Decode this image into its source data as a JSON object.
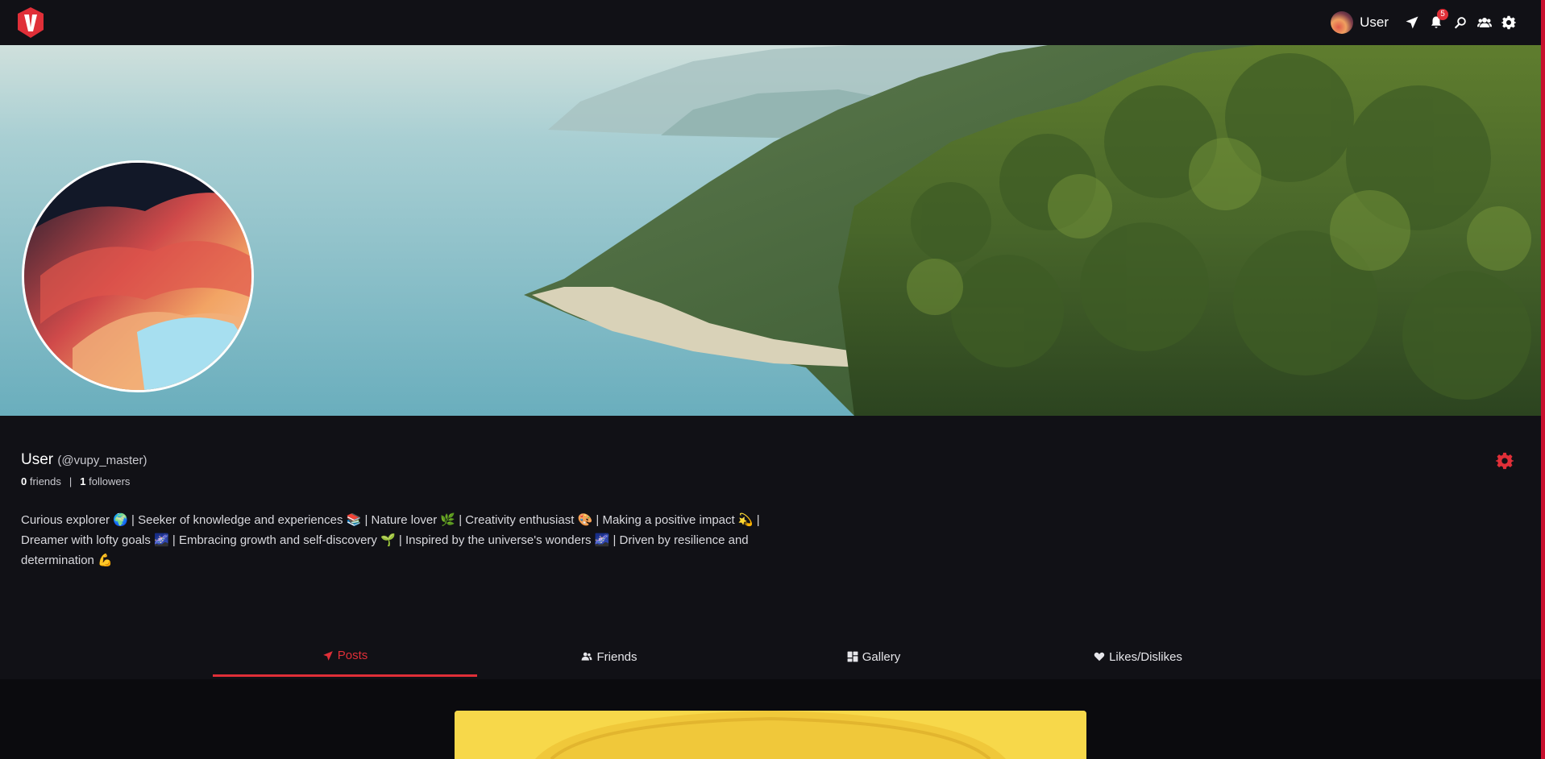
{
  "navbar": {
    "username": "User",
    "notification_count": "5",
    "icons": [
      "logo-v-icon",
      "send-icon",
      "bell-icon",
      "search-icon",
      "users-icon",
      "gear-icon"
    ]
  },
  "profile": {
    "name": "User",
    "handle": "(@vupy_master)",
    "friends_count": "0",
    "friends_label": "friends",
    "separator": "|",
    "followers_count": "1",
    "followers_label": "followers",
    "bio_line1": "Curious explorer 🌍 | Seeker of knowledge and experiences 📚 | Nature lover 🌿 | Creativity enthusiast 🎨 | Making a positive impact 💫 |",
    "bio_line2": "Dreamer with lofty goals 🌌 | Embracing growth and self-discovery 🌱 | Inspired by the universe's wonders 🌌 | Driven by resilience and",
    "bio_line3": "determination 💪"
  },
  "tabs": [
    {
      "label": "Posts",
      "icon": "send-icon",
      "active": true
    },
    {
      "label": "Friends",
      "icon": "users-icon",
      "active": false
    },
    {
      "label": "Gallery",
      "icon": "grid-icon",
      "active": false
    },
    {
      "label": "Likes/Dislikes",
      "icon": "heart-icon",
      "active": false
    }
  ],
  "colors": {
    "background": "#111116",
    "accent": "#e02f38",
    "text": "#e8e8ea",
    "post_card": "#f7d84a"
  }
}
